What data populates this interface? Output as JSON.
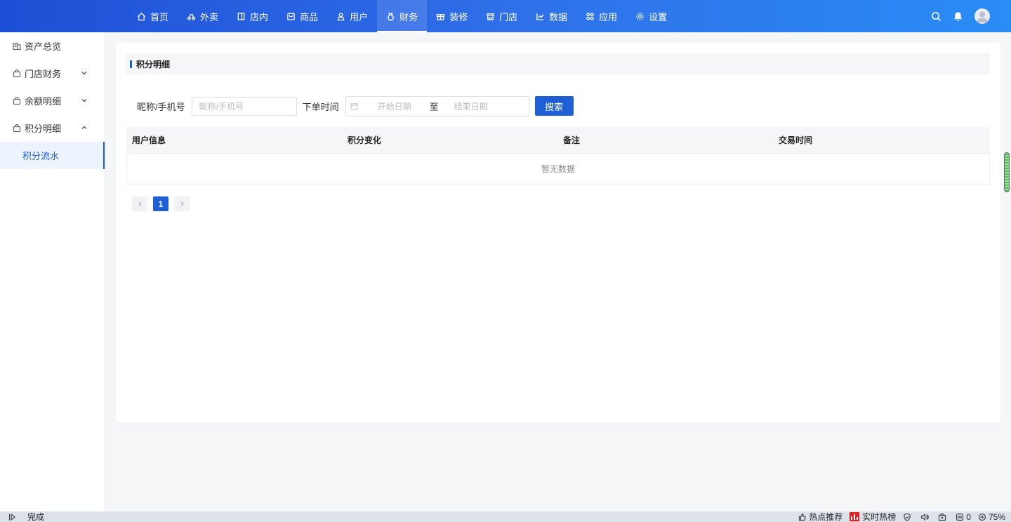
{
  "nav": {
    "items": [
      {
        "label": "首页",
        "icon": "home-icon"
      },
      {
        "label": "外卖",
        "icon": "delivery-icon"
      },
      {
        "label": "店内",
        "icon": "store-in-icon"
      },
      {
        "label": "商品",
        "icon": "product-icon"
      },
      {
        "label": "用户",
        "icon": "user-icon"
      },
      {
        "label": "财务",
        "icon": "finance-icon"
      },
      {
        "label": "装修",
        "icon": "decorate-icon"
      },
      {
        "label": "门店",
        "icon": "shop-icon"
      },
      {
        "label": "数据",
        "icon": "chart-icon"
      },
      {
        "label": "应用",
        "icon": "apps-icon"
      },
      {
        "label": "设置",
        "icon": "gear-icon"
      }
    ],
    "active": "财务"
  },
  "sidebar": {
    "items": [
      {
        "label": "资产总览"
      },
      {
        "label": "门店财务"
      },
      {
        "label": "余额明细"
      },
      {
        "label": "积分明细"
      }
    ],
    "sub_active": "积分流水"
  },
  "main": {
    "section_title": "积分明细",
    "filter": {
      "nickname_label": "昵称/手机号",
      "nickname_placeholder": "昵称/手机号",
      "time_label": "下单时间",
      "start_placeholder": "开始日期",
      "range_sep": "至",
      "end_placeholder": "结束日期",
      "search_label": "搜索"
    },
    "table": {
      "columns": [
        "用户信息",
        "积分变化",
        "备注",
        "交易时间"
      ],
      "empty_text": "暂无数据"
    },
    "pager": {
      "current": "1"
    }
  },
  "statusbar": {
    "left_text": "完成",
    "hot_recommend": "热点推荐",
    "realtime_hot": "实时热榜",
    "count": "0",
    "zoom": "75%"
  },
  "colors": {
    "accent": "#1f5fd6",
    "topbar_start": "#1e4fd6",
    "topbar_end": "#2a8cf5"
  }
}
